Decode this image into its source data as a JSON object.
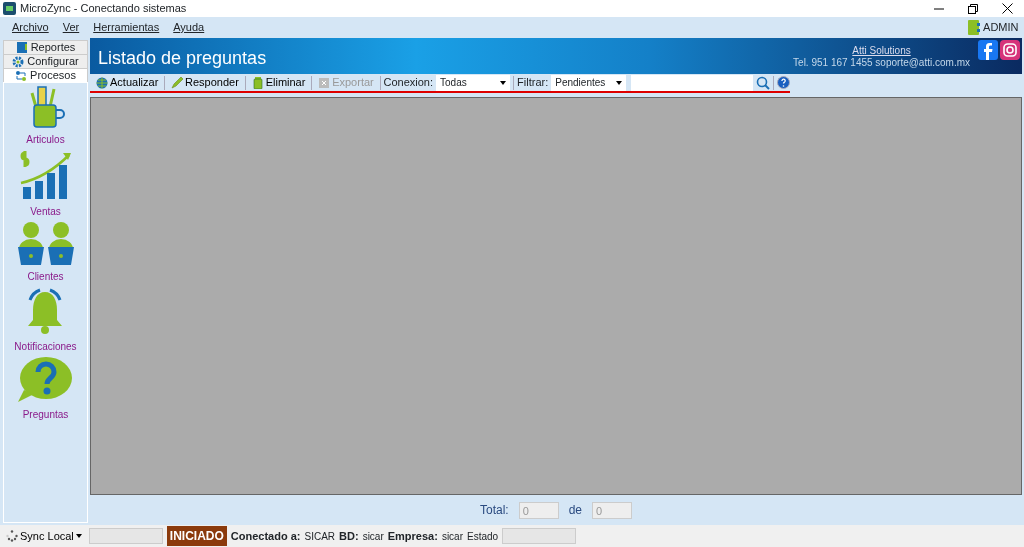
{
  "window": {
    "title": "MicroZync - Conectando sistemas"
  },
  "menu": [
    "Archivo",
    "Ver",
    "Herramientas",
    "Ayuda"
  ],
  "user": "ADMIN",
  "side_tabs": [
    {
      "label": "Reportes",
      "kind": "report",
      "selected": false
    },
    {
      "label": "Configurar",
      "kind": "gear",
      "selected": false
    },
    {
      "label": "Procesos",
      "kind": "process",
      "selected": true
    }
  ],
  "side_items": [
    {
      "label": "Articulos",
      "kind": "articles"
    },
    {
      "label": "Ventas",
      "kind": "sales"
    },
    {
      "label": "Clientes",
      "kind": "clients"
    },
    {
      "label": "Notificaciones",
      "kind": "bell"
    },
    {
      "label": "Preguntas",
      "kind": "question"
    }
  ],
  "header": {
    "title": "Listado de preguntas",
    "company": "Atti Solutions",
    "contact": "Tel. 951 167 1455  soporte@atti.com.mx"
  },
  "toolbar": [
    {
      "label": "Actualizar",
      "kind": "globe",
      "disabled": false
    },
    {
      "label": "Responder",
      "kind": "pencil",
      "disabled": false
    },
    {
      "label": "Eliminar",
      "kind": "trash",
      "disabled": false
    },
    {
      "label": "Exportar",
      "kind": "export",
      "disabled": true
    }
  ],
  "filters": [
    {
      "label": "Conexion:",
      "value": "Todas"
    },
    {
      "label": "Filtrar:",
      "value": "Pendientes"
    }
  ],
  "footer": {
    "total_label": "Total:",
    "total": "0",
    "of_label": "de",
    "of": "0"
  },
  "status_bar": {
    "sync": "Sync Local",
    "state": "INICIADO",
    "fields": [
      {
        "label": "Conectado a:",
        "value": "SICAR"
      },
      {
        "label": "BD:",
        "value": "sicar"
      },
      {
        "label": "Empresa:",
        "value": "sicar"
      }
    ],
    "estado_label": "Estado"
  }
}
